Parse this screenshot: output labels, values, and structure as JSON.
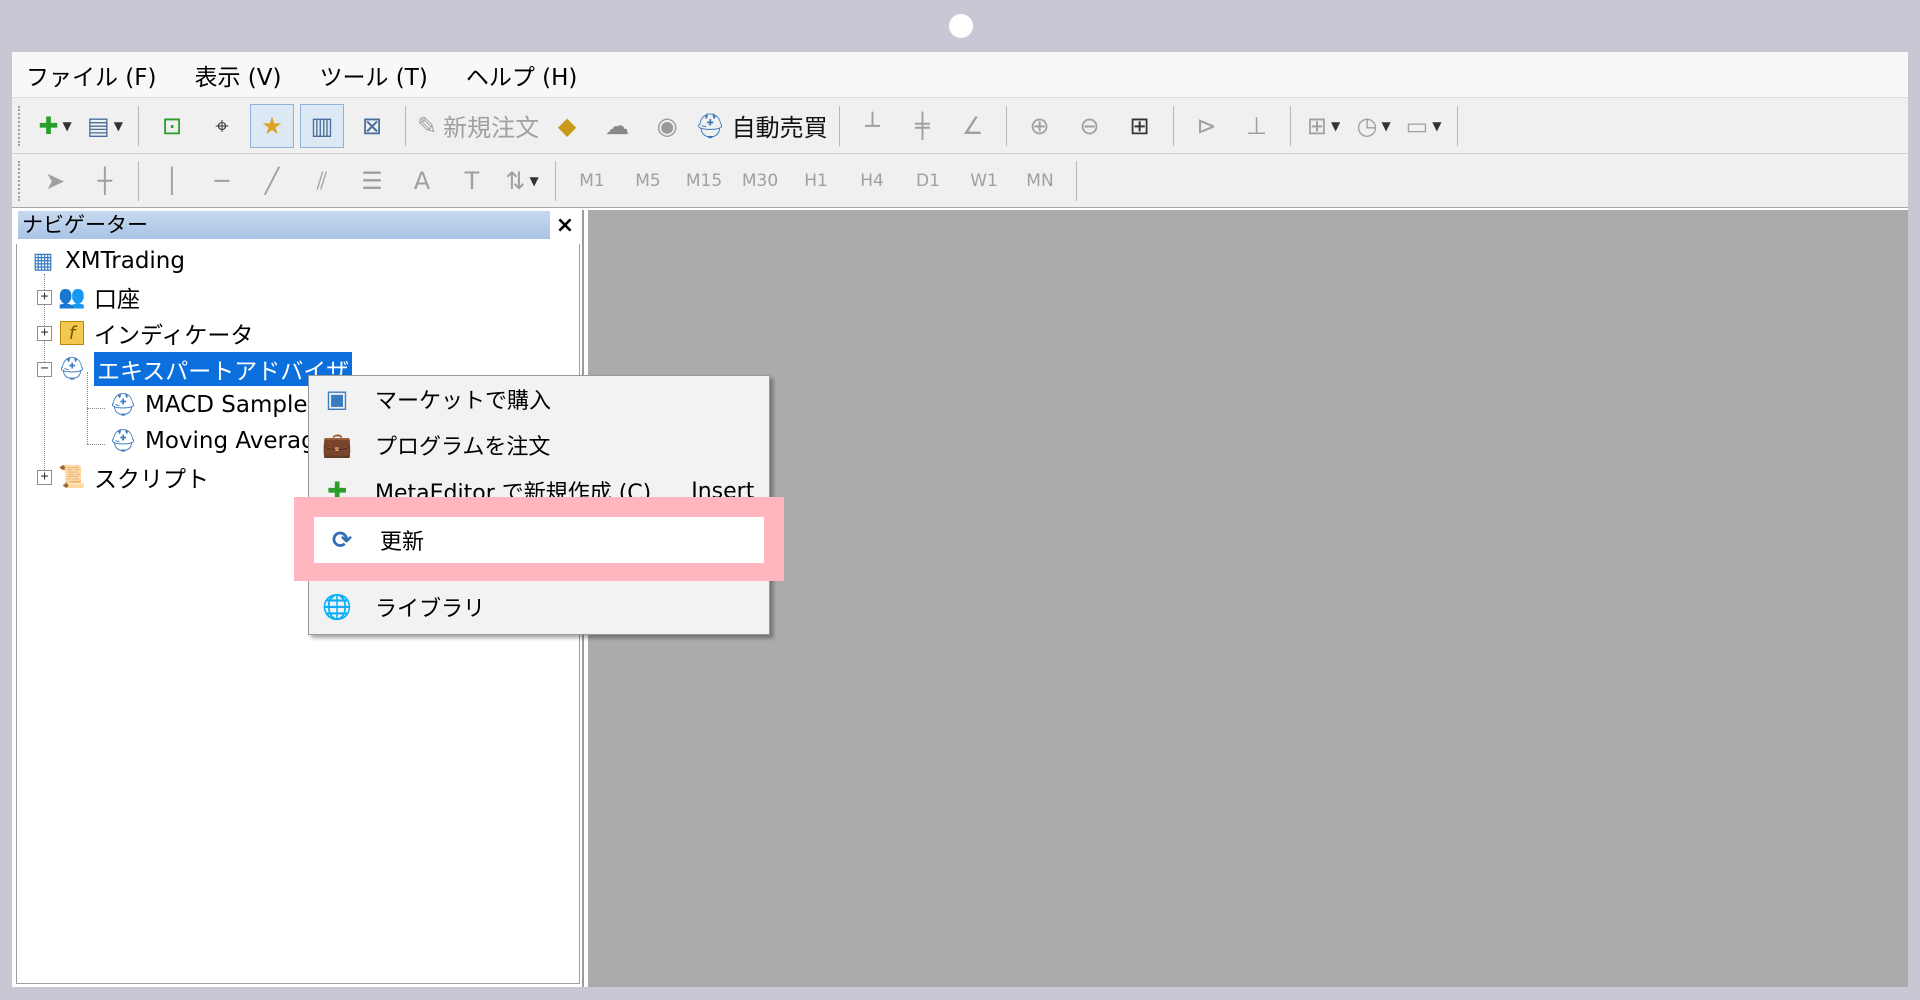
{
  "menubar": {
    "items": [
      {
        "label": "ファイル (F)"
      },
      {
        "label": "表示 (V)"
      },
      {
        "label": "ツール (T)"
      },
      {
        "label": "ヘルプ (H)"
      }
    ]
  },
  "toolbar": {
    "new_order_label": "新規注文",
    "auto_trading_label": "自動売買"
  },
  "timeframes": [
    "M1",
    "M5",
    "M15",
    "M30",
    "H1",
    "H4",
    "D1",
    "W1",
    "MN"
  ],
  "navigator": {
    "title": "ナビゲーター",
    "close_label": "×",
    "root": "XMTrading",
    "items": [
      {
        "label": "口座"
      },
      {
        "label": "インディケータ"
      },
      {
        "label": "エキスパートアドバイザ"
      },
      {
        "label": "MACD Sample"
      },
      {
        "label": "Moving Average"
      },
      {
        "label": "スクリプト"
      }
    ]
  },
  "context_menu": {
    "items": [
      {
        "label": "マーケットで購入"
      },
      {
        "label": "プログラムを注文"
      },
      {
        "label": "MetaEditor で新規作成 (C)",
        "shortcut": "Insert"
      },
      {
        "label": "更新"
      },
      {
        "label": "ライブラリ"
      }
    ]
  },
  "colors": {
    "selection": "#0b6fdd",
    "highlight": "#ffb6bf",
    "chart_bg": "#ababab"
  }
}
